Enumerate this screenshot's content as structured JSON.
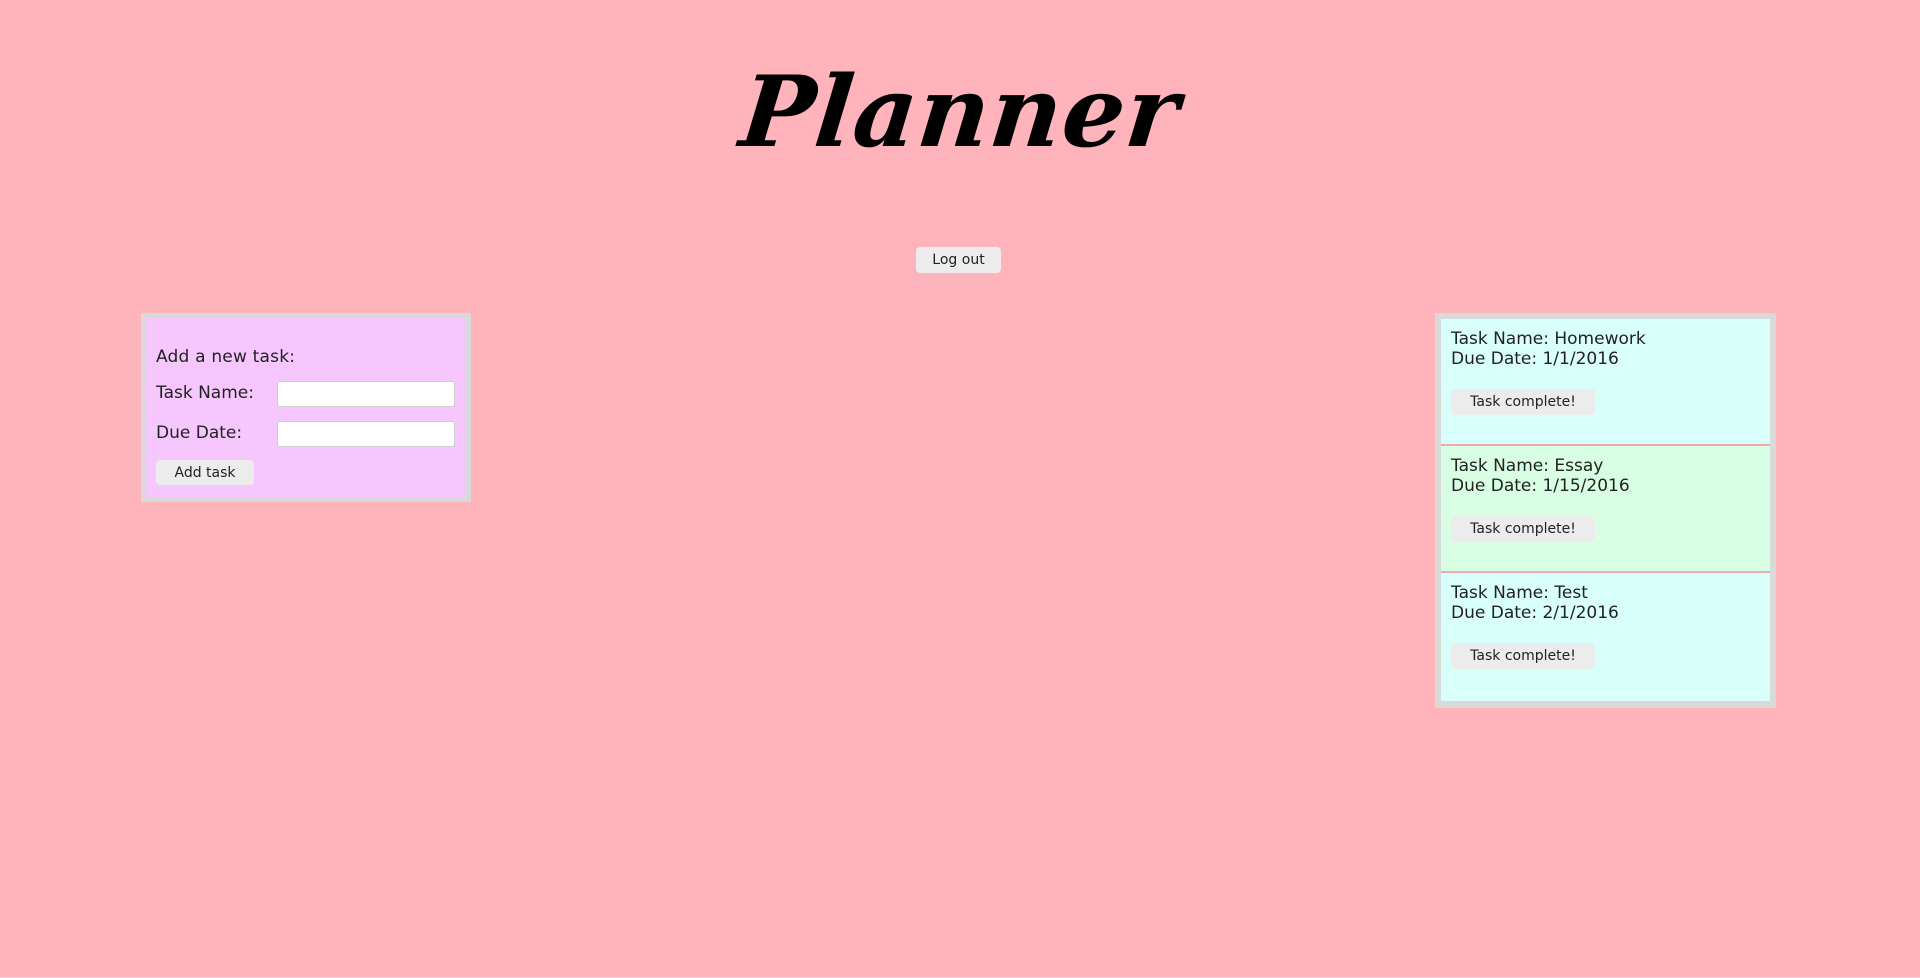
{
  "header": {
    "title": "Planner",
    "logout_label": "Log out"
  },
  "new_task": {
    "heading": "Add a new task:",
    "task_name_label": "Task Name:",
    "task_name_value": "",
    "due_date_label": "Due Date:",
    "due_date_value": "",
    "add_button_label": "Add task"
  },
  "tasks": [
    {
      "name_text": "Task Name: Homework",
      "due_text": "Due Date: 1/1/2016",
      "button_label": "Task complete!",
      "color": "#d8fff9"
    },
    {
      "name_text": "Task Name: Essay",
      "due_text": "Due Date: 1/15/2016",
      "button_label": "Task complete!",
      "color": "#d8ffe4"
    },
    {
      "name_text": "Task Name: Test",
      "due_text": "Due Date: 2/1/2016",
      "button_label": "Task complete!",
      "color": "#d8fff9"
    }
  ],
  "colors": {
    "page_background": "#ffb3bb",
    "new_task_card": "#f6c6ff",
    "card_border": "#d9d9d9",
    "button": "#ececec"
  }
}
